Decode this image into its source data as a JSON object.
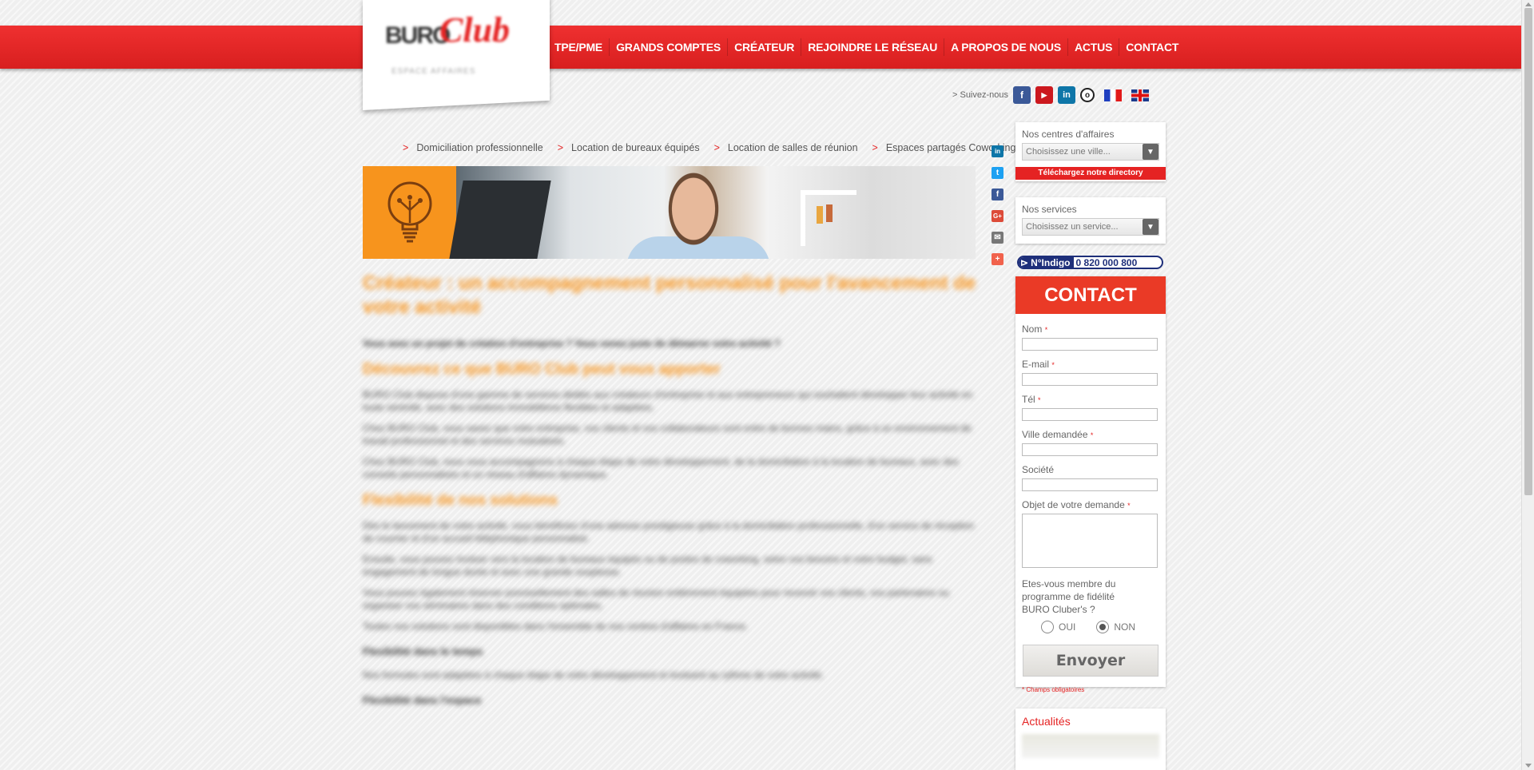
{
  "logo": {
    "buro": "BURO",
    "club": "Club",
    "tagline": "ESPACE AFFAIRES"
  },
  "nav": [
    {
      "label": "TPE/PME"
    },
    {
      "label": "GRANDS COMPTES"
    },
    {
      "label": "CRÉATEUR"
    },
    {
      "label": "REJOINDRE LE RÉSEAU"
    },
    {
      "label": "A PROPOS DE NOUS"
    },
    {
      "label": "ACTUS"
    },
    {
      "label": "CONTACT"
    }
  ],
  "follow": {
    "label": "> Suivez-nous",
    "networks": [
      {
        "icon": "facebook-icon",
        "glyph": "f",
        "color": "#3b5998"
      },
      {
        "icon": "youtube-icon",
        "glyph": "▶",
        "color": "#cc181e"
      },
      {
        "icon": "linkedin-icon",
        "glyph": "in",
        "color": "#0e76a8"
      },
      {
        "icon": "viadeo-icon",
        "glyph": "o",
        "color": "#222222"
      }
    ]
  },
  "subnav": [
    {
      "arrow": ">",
      "label": "Domiciliation professionnelle"
    },
    {
      "arrow": ">",
      "label": "Location de bureaux équipés"
    },
    {
      "arrow": ">",
      "label": "Location de salles de réunion"
    },
    {
      "arrow": ">",
      "label": "Espaces partagés Coworking"
    }
  ],
  "content": {
    "title": "Créateur : un accompagnement personnalisé pour l'avancement de votre activité",
    "lead": "Vous avez un projet de création d'entreprise ? Vous venez juste de démarrer votre activité ?",
    "section1": "Découvrez ce que BURO Club peut vous apporter",
    "p1": "BURO Club dispose d'une gamme de services dédiés aux créateurs d'entreprise et aux entrepreneurs qui souhaitent développer leur activité en toute sérénité, avec des solutions immobilières flexibles et adaptées.",
    "p2": "Chez BURO Club, vous savez que votre entreprise, vos clients et vos collaborateurs sont entre de bonnes mains, grâce à un environnement de travail professionnel et des services mutualisés.",
    "p3": "Chez BURO Club, nous vous accompagnons à chaque étape de votre développement, de la domiciliation à la location de bureaux, avec des conseils personnalisés et un réseau d'affaires dynamique.",
    "section2": "Flexibilité de nos solutions",
    "p4": "Dès le lancement de votre activité, vous bénéficiez d'une adresse prestigieuse grâce à la domiciliation professionnelle, d'un service de réception de courrier et d'un accueil téléphonique personnalisé.",
    "p5": "Ensuite, vous pouvez évoluer vers la location de bureaux équipés ou de postes de coworking, selon vos besoins et votre budget, sans engagement de longue durée et avec une grande souplesse.",
    "p6": "Vous pouvez également réserver ponctuellement des salles de réunion entièrement équipées pour recevoir vos clients, vos partenaires ou organiser vos séminaires dans des conditions optimales.",
    "p7": "Toutes nos solutions sont disponibles dans l'ensemble de nos centres d'affaires en France.",
    "h3a": "Flexibilité dans le temps",
    "p8": "Nos formules sont adaptées à chaque étape de votre développement et évoluent au rythme de votre activité.",
    "h3b": "Flexibilité dans l'espace"
  },
  "share": [
    {
      "icon": "linkedin-share-icon",
      "glyph": "in",
      "color": "#0e76a8"
    },
    {
      "icon": "twitter-share-icon",
      "glyph": "t",
      "color": "#1da1f2"
    },
    {
      "icon": "facebook-share-icon",
      "glyph": "f",
      "color": "#3b5998"
    },
    {
      "icon": "googleplus-share-icon",
      "glyph": "G+",
      "color": "#dd4b39"
    },
    {
      "icon": "email-share-icon",
      "glyph": "✉",
      "color": "#777777"
    },
    {
      "icon": "more-share-icon",
      "glyph": "+",
      "color": "#f1624c"
    }
  ],
  "sidebar": {
    "centres_title": "Nos centres d'affaires",
    "centres_placeholder": "Choisissez une ville...",
    "directory": "Téléchargez notre directory",
    "services_title": "Nos services",
    "services_placeholder": "Choisissez un service...",
    "indigo_label": "N°Indigo",
    "indigo_number": "0 820 000 800"
  },
  "contact": {
    "title": "CONTACT",
    "fields": {
      "nom": "Nom",
      "email": "E-mail",
      "tel": "Tél",
      "ville": "Ville demandée",
      "societe": "Société",
      "objet": "Objet de votre demande"
    },
    "req_star": "*",
    "member_q": "Etes-vous membre du programme de fidélité BURO Cluber's ?",
    "oui": "OUI",
    "non": "NON",
    "selected": "NON",
    "send": "Envoyer",
    "required_note": "* Champs obligatoires"
  },
  "news": {
    "title": "Actualités"
  },
  "colors": {
    "brand_red": "#e52323",
    "orange": "#f7941d",
    "contact_red": "#ea3a26",
    "indigo_blue": "#1e2f7a"
  }
}
